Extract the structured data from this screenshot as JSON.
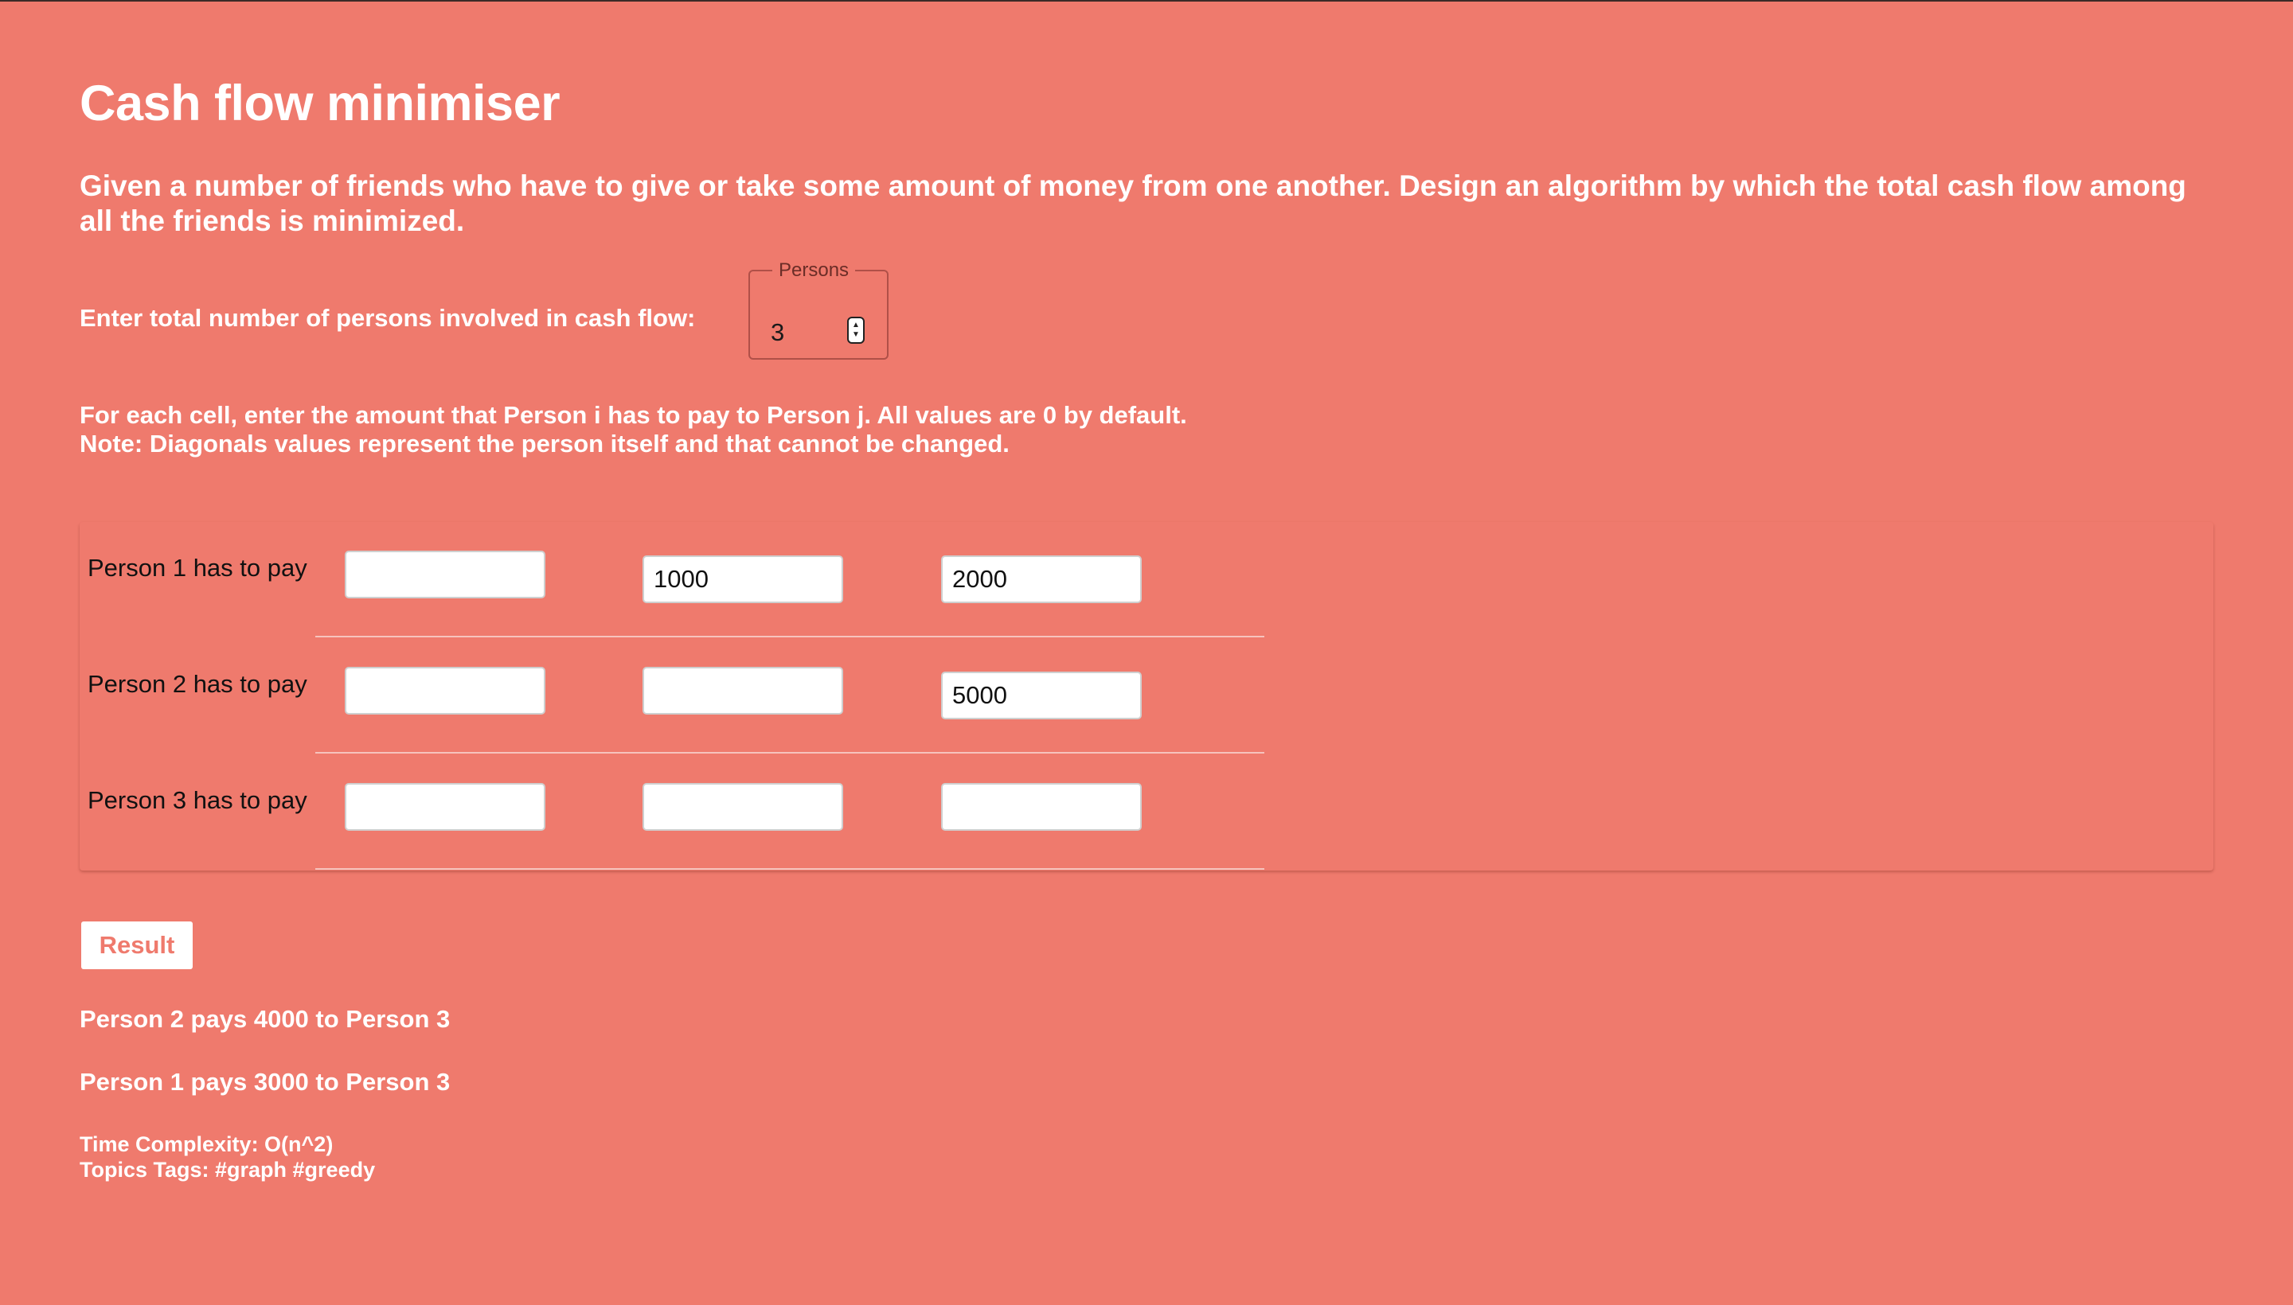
{
  "page": {
    "title": "Cash flow minimiser",
    "description": "Given a number of friends who have to give or take some amount of money from one another. Design an algorithm by which the total cash flow among all the friends is minimized."
  },
  "persons": {
    "label": "Enter total number of persons involved in cash flow:",
    "field_legend": "Persons",
    "value": "3"
  },
  "instructions": {
    "line1": "For each cell, enter the amount that Person i has to pay to Person j. All values are 0 by default.",
    "line2": "Note: Diagonals values represent the person itself and that cannot be changed."
  },
  "matrix": {
    "rows": [
      {
        "label": "Person 1 has to pay",
        "cells": [
          "",
          "1000",
          "2000"
        ]
      },
      {
        "label": "Person 2 has to pay",
        "cells": [
          "",
          "",
          "5000"
        ]
      },
      {
        "label": "Person 3 has to pay",
        "cells": [
          "",
          "",
          ""
        ]
      }
    ]
  },
  "result_button": {
    "label": "Result"
  },
  "results": [
    "Person 2 pays 4000 to Person 3",
    "Person 1 pays 3000 to Person 3"
  ],
  "meta": {
    "time_complexity": "Time Complexity: O(n^2)",
    "topic_tags": "Topics Tags: #graph #greedy"
  },
  "colors": {
    "background": "#ef7a6d",
    "text": "#ffffff",
    "button_text": "#ef7a6d"
  }
}
